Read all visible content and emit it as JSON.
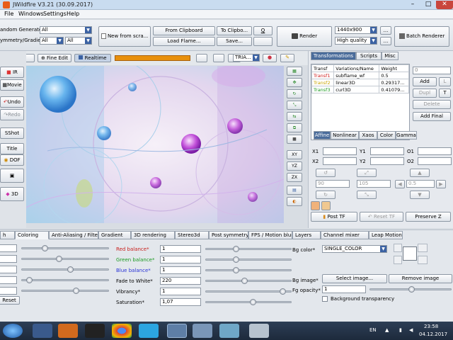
{
  "window": {
    "title": "JWildfire V3.21 (30.09.2017)"
  },
  "menu": [
    "File",
    "Windows",
    "Settings",
    "Help"
  ],
  "toolbar": {
    "random_generator_label": "andom Generator",
    "random_generator_value": "All",
    "symmetry_label": "ymmetry/Gradient",
    "symmetry_value": "All",
    "symmetry_value2": "All",
    "new_from_scratch": "New from scra...",
    "from_clipboard": "From Clipboard",
    "to_clipboard": "To Clipbo...",
    "load_flame": "Load Flame...",
    "save": "Save...",
    "q_button": "Q",
    "render": "Render",
    "resolution": "1440x900",
    "quality": "High quality",
    "more1": "...",
    "more2": "...",
    "batch_renderer": "Batch Renderer"
  },
  "edit_bar": {
    "fine_edit": "Fine Edit",
    "realtime": "Realtime",
    "triangle_mode": "TRIA..."
  },
  "left_panel": {
    "ir": "IR",
    "movie": "Movie",
    "undo": "Undo",
    "redo": "Redo",
    "sshot": "SShot",
    "title": "Title",
    "dof": "DOF",
    "three_d": "3D"
  },
  "right_icons": {
    "xy": "XY",
    "yz": "YZ",
    "zx": "ZX"
  },
  "right_panel": {
    "tabs": [
      "Transformations",
      "Scripts",
      "Misc"
    ],
    "table_headers": [
      "Transf",
      "Variations/Name",
      "Weight"
    ],
    "transforms": [
      {
        "name": "Transf1",
        "variation": "subflame_wf",
        "weight": "0.5",
        "color": "#d02020"
      },
      {
        "name": "Transf2",
        "variation": "linear3D",
        "weight": "0.29317...",
        "color": "#c9a400"
      },
      {
        "name": "Transf3",
        "variation": "curl3D",
        "weight": "0.41079...",
        "color": "#1e9a22"
      }
    ],
    "weight_field": "0",
    "add": "Add",
    "l_button": "L",
    "dupl": "Dupl",
    "t_button": "T",
    "delete": "Delete",
    "add_final": "Add Final",
    "sub_tabs": [
      "Affine",
      "Nonlinear",
      "Xaos",
      "Color",
      "Gamma"
    ],
    "affine_labels": [
      "X1",
      "Y1",
      "O1",
      "X2",
      "Y2",
      "O2"
    ],
    "affine_values": [
      "",
      "",
      "",
      "",
      "",
      ""
    ],
    "rotate_value": "90",
    "scale_value": "105",
    "move_value": "0.5",
    "post_tf": "Post TF",
    "reset_tf": "Reset TF",
    "preserve_z": "Preserve Z"
  },
  "bottom": {
    "tabs": [
      "h",
      "Coloring",
      "Anti-Aliasing / Filter",
      "Gradient",
      "3D rendering",
      "Stereo3d",
      "Post symmetry",
      "FPS / Motion blur",
      "Layers",
      "Channel mixer",
      "Leap Motion"
    ],
    "red_balance": "Red balance*",
    "red_value": "1",
    "green_balance": "Green balance*",
    "green_value": "1",
    "blue_balance": "Blue balance*",
    "blue_value": "1",
    "fade_to_white": "Fade to White*",
    "fade_value": "220",
    "vibrancy": "Vibrancy*",
    "vibrancy_value": "1",
    "saturation": "Saturation*",
    "saturation_value": "1,07",
    "reset": "Reset",
    "bg_color": "Bg color*",
    "bg_color_mode": "SINGLE_COLOR",
    "bg_image": "Bg image*",
    "select_image": "Select image...",
    "remove_image": "Remove image",
    "fg_opacity": "Fg opacity*",
    "fg_opacity_value": "1",
    "bg_transparency": "Background transparency"
  },
  "taskbar": {
    "lang": "EN",
    "time": "23:58",
    "date": "04.12.2017"
  }
}
